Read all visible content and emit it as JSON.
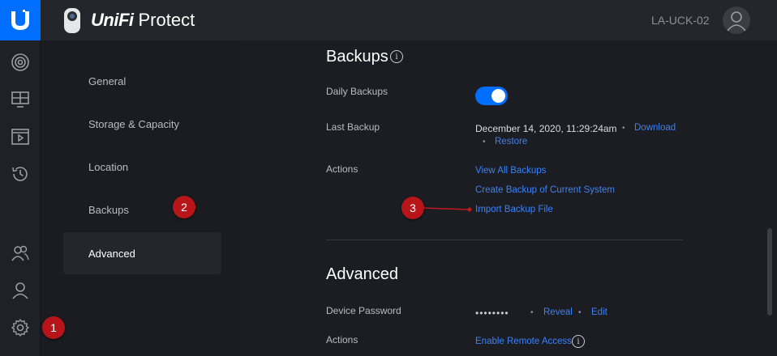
{
  "header": {
    "brand_unifi": "UniFi",
    "brand_product": "Protect",
    "device_name": "LA-UCK-02"
  },
  "rail": {
    "icons": [
      "unifi-logo-icon",
      "camera-dome-icon",
      "display-grid-icon",
      "video-clip-icon",
      "history-icon",
      "users-icon",
      "user-icon",
      "gear-icon"
    ]
  },
  "settings_nav": {
    "items": [
      {
        "label": "General"
      },
      {
        "label": "Storage & Capacity"
      },
      {
        "label": "Location"
      },
      {
        "label": "Backups"
      },
      {
        "label": "Advanced",
        "active": true
      }
    ]
  },
  "backups": {
    "title": "Backups",
    "daily_label": "Daily Backups",
    "daily_enabled": true,
    "last_label": "Last Backup",
    "last_value": "December 14, 2020, 11:29:24am",
    "download_link": "Download",
    "restore_link": "Restore",
    "actions_label": "Actions",
    "view_all": "View All Backups",
    "create_backup": "Create Backup of Current System",
    "import_backup": "Import Backup File"
  },
  "advanced": {
    "title": "Advanced",
    "password_label": "Device Password",
    "password_mask": "••••••••",
    "reveal_link": "Reveal",
    "edit_link": "Edit",
    "actions_label": "Actions",
    "remote_access": "Enable Remote Access"
  },
  "annotations": {
    "marker1": "1",
    "marker2": "2",
    "marker3": "3"
  },
  "colors": {
    "accent": "#006fff",
    "link": "#3b82f6",
    "marker": "#b8151b"
  }
}
